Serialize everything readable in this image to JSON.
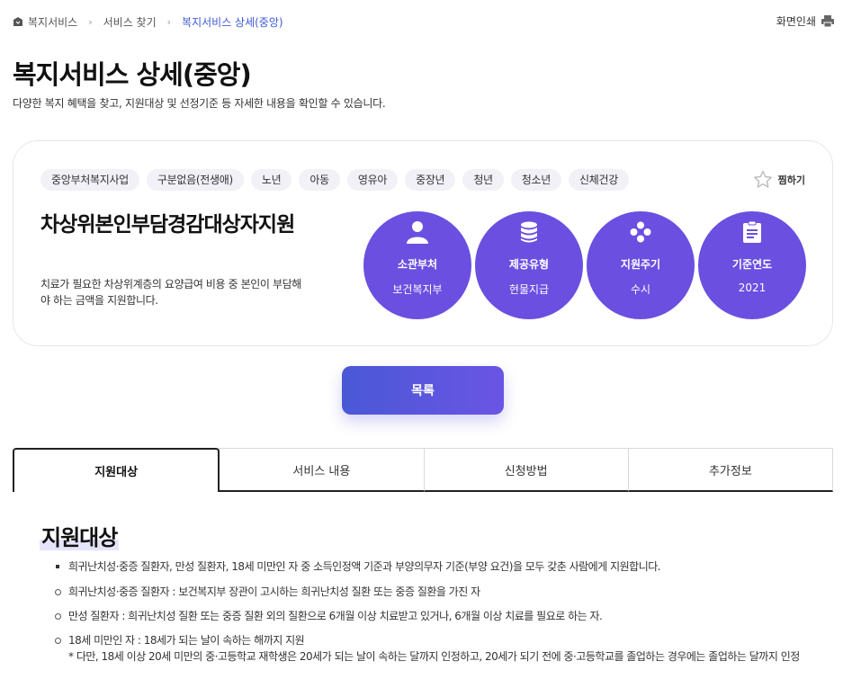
{
  "breadcrumb": {
    "items": [
      "복지서비스",
      "서비스 찾기"
    ],
    "current": "복지서비스 상세(중앙)"
  },
  "print_label": "화면인쇄",
  "page": {
    "title": "복지서비스 상세(중앙)",
    "description": "다양한 복지 혜택을 찾고, 지원대상 및 선정기준 등 자세한 내용을 확인할 수 있습니다."
  },
  "card": {
    "tags": [
      "중앙부처복지사업",
      "구분없음(전생애)",
      "노년",
      "아동",
      "영유아",
      "중장년",
      "청년",
      "청소년",
      "신체건강"
    ],
    "favorite_label": "찜하기",
    "service_title": "차상위본인부담경감대상자지원",
    "service_desc": "치료가 필요한 차상위계층의 요양급여 비용 중 본인이 부담해야 하는 금액을 지원합니다.",
    "info": [
      {
        "label": "소관부처",
        "value": "보건복지부",
        "icon": "person-icon"
      },
      {
        "label": "제공유형",
        "value": "현물지급",
        "icon": "database-icon"
      },
      {
        "label": "지원주기",
        "value": "수시",
        "icon": "dots-icon"
      },
      {
        "label": "기준연도",
        "value": "2021",
        "icon": "document-icon"
      }
    ]
  },
  "list_button_label": "목록",
  "tabs": [
    "지원대상",
    "서비스 내용",
    "신청방법",
    "추가정보"
  ],
  "section": {
    "title": "지원대상",
    "bullets": [
      "희귀난치성·중증 질환자, 만성 질환자, 18세 미만인 자 중 소득인정액 기준과 부양의무자 기준(부양 요건)을 모두 갖춘 사람에게 지원합니다.",
      "희귀난치성·중증 질환자 : 보건복지부 장관이 고시하는 희귀난치성 질환 또는 중증 질환을 가진 자",
      "만성 질환자 : 희귀난치성 질환 또는 중증 질환 외의 질환으로 6개월 이상 치료받고 있거나, 6개월 이상 치료를 필요로 하는 자.",
      "18세 미만인 자 : 18세가 되는 날이 속하는 해까지 지원"
    ],
    "note": "* 다만, 18세 이상 20세 미만의 중·고등학교 재학생은 20세가 되는 날이 속하는 달까지 인정하고, 20세가 되기 전에 중·고등학교를 졸업하는 경우에는 졸업하는 달까지 인정"
  },
  "colors": {
    "accent": "#6b4fe0",
    "breadcrumb_current": "#3d5ad6",
    "tag_bg": "#f1f1f7"
  }
}
